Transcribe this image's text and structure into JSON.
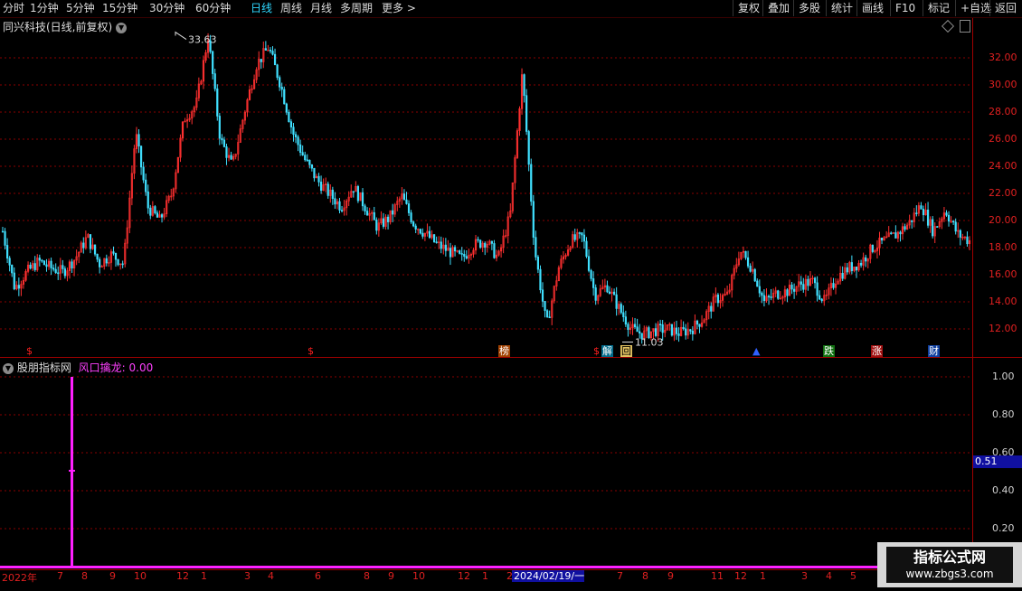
{
  "toolbar": {
    "periods": [
      "分时",
      "1分钟",
      "5分钟",
      "15分钟",
      "30分钟",
      "60分钟",
      "日线",
      "周线",
      "月线",
      "多周期",
      "更多 >"
    ],
    "active_index": 6,
    "buttons": [
      "复权",
      "叠加",
      "多股",
      "统计",
      "画线",
      "F10",
      "标记",
      "+自选",
      "返回"
    ]
  },
  "main_panel": {
    "title": "同兴科技(日线,前复权)",
    "price_axis": [
      "32.00",
      "30.00",
      "28.00",
      "26.00",
      "24.00",
      "22.00",
      "20.00",
      "18.00",
      "16.00",
      "14.00",
      "12.00"
    ],
    "high_marker": "33.63",
    "low_marker": "11.03",
    "event_marks": [
      {
        "text": "$",
        "color": "#ff2020",
        "bg": ""
      },
      {
        "text": "$",
        "color": "#ff2020",
        "bg": ""
      },
      {
        "text": "榜",
        "color": "#ffffff",
        "bg": "#a04000"
      },
      {
        "text": "$",
        "color": "#ff2020",
        "bg": ""
      },
      {
        "text": "解",
        "color": "#ffffff",
        "bg": "#006a8a"
      },
      {
        "text": "回",
        "color": "#000000",
        "bg": "#e0c060"
      },
      {
        "text": "▲",
        "color": "#3060ff",
        "bg": ""
      },
      {
        "text": "跌",
        "color": "#ffffff",
        "bg": "#107010"
      },
      {
        "text": "涨",
        "color": "#ffffff",
        "bg": "#a01010"
      },
      {
        "text": "财",
        "color": "#ffffff",
        "bg": "#1040a0"
      }
    ]
  },
  "indicator_panel": {
    "source": "股朋指标网",
    "name": "风口擒龙",
    "value_label": "风口擒龙: 0.00",
    "axis": [
      "1.00",
      "0.80",
      "0.60",
      "0.40",
      "0.20"
    ],
    "current_value": "0.51"
  },
  "date_axis": {
    "labels": [
      "2022年",
      "7",
      "8",
      "9",
      "10",
      "12",
      "1",
      "3",
      "4",
      "6",
      "8",
      "9",
      "10",
      "12",
      "1",
      "2",
      "7",
      "8",
      "9",
      "11",
      "12",
      "1",
      "3",
      "4",
      "5"
    ],
    "cursor_date": "2024/02/19/一"
  },
  "watermark": {
    "line1": "指标公式网",
    "line2": "www.zbgs3.com"
  },
  "colors": {
    "up": "#ff3030",
    "down": "#40e0ff",
    "indicator": "#ff20ff",
    "grid": "#8a0000"
  },
  "chart_data": {
    "type": "line",
    "ylim": [
      11,
      34
    ],
    "series": [
      {
        "values": [
          19.2,
          15.0,
          16.2,
          17.0,
          16.5,
          16.2,
          17.2,
          18.8,
          16.8,
          17.5,
          16.8,
          26.5,
          21.0,
          20.0,
          22.0,
          27.5,
          28.5,
          33.6,
          26.0,
          24.0,
          28.0,
          31.5,
          32.8,
          30.0,
          26.5,
          24.5,
          23.0,
          22.0,
          21.0,
          22.5,
          21.0,
          19.5,
          20.2,
          21.8,
          19.8,
          19.0,
          18.2,
          17.7,
          17.2,
          18.2,
          18.5,
          17.2,
          20.5,
          31.0,
          18.0,
          12.2,
          16.5,
          18.5,
          18.8,
          14.5,
          15.2,
          13.5,
          12.0,
          11.6,
          11.9,
          12.0,
          11.7,
          12.0,
          12.8,
          14.2,
          14.5,
          17.8,
          16.5,
          14.0,
          14.6,
          14.8,
          15.3,
          15.5,
          14.0,
          15.8,
          16.5,
          16.9,
          18.0,
          18.5,
          19.0,
          19.8,
          21.2,
          19.2,
          20.8,
          19.0,
          18.5
        ]
      }
    ]
  }
}
